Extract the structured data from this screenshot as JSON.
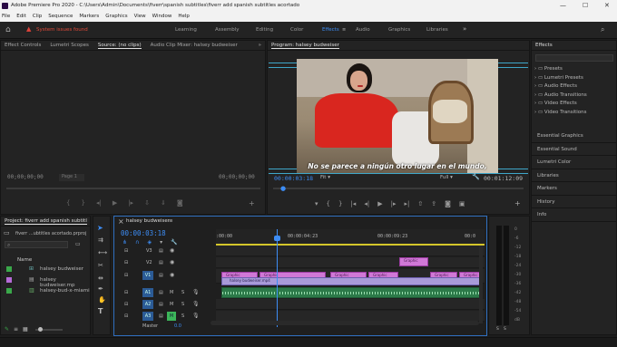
{
  "app": {
    "title": "Adobe Premiere Pro 2020 - C:\\Users\\Admin\\Documents\\fiverr\\spanish subtitles\\fiverr add spanish subtitles acortado",
    "window_controls": [
      "—",
      "☐",
      "✕"
    ]
  },
  "menu": [
    "File",
    "Edit",
    "Clip",
    "Sequence",
    "Markers",
    "Graphics",
    "View",
    "Window",
    "Help"
  ],
  "workspace": {
    "home_icon": "home-icon",
    "alert": "System issues found",
    "tabs": [
      "Learning",
      "Assembly",
      "Editing",
      "Color",
      "Effects",
      "Audio",
      "Graphics",
      "Libraries"
    ],
    "active_tab": "Effects",
    "accent": "#3d8df5"
  },
  "source_panel": {
    "tabs": [
      "Effect Controls",
      "Lumetri Scopes",
      "Source: (no clips)",
      "Audio Clip Mixer: halsey budweiser"
    ],
    "active": "Source: (no clips)",
    "tc_left": "00;00;00;00",
    "page": "Page 1",
    "tc_right": "00;00;00;00"
  },
  "program": {
    "title": "Program: halsey budweiser",
    "subtitle": "No se parece a ningún otro lugar en el mundo,",
    "timecode": "00:00:03:18",
    "fit": "Fit",
    "quality": "Full",
    "duration": "00:01:12:09"
  },
  "effects": {
    "title": "Effects",
    "folders": [
      "Presets",
      "Lumetri Presets",
      "Audio Effects",
      "Audio Transitions",
      "Video Effects",
      "Video Transitions"
    ],
    "panels": [
      "Essential Graphics",
      "Essential Sound",
      "Lumetri Color",
      "Libraries",
      "Markers",
      "History",
      "Info"
    ]
  },
  "project": {
    "title": "Project: fiverr add spanish subtitl",
    "file": "fiverr ...ubtitles acortado.prproj",
    "name_header": "Name",
    "items": [
      {
        "name": "halsey budweiser",
        "color": "#3aa84a"
      },
      {
        "name": "halsey budweiser.mp",
        "color": "#b66bd8"
      },
      {
        "name": "halsey-bud-x-miami",
        "color": "#3aa84a"
      }
    ]
  },
  "timeline": {
    "title": "halsey budweiser",
    "timecode": "00:00:03:18",
    "ruler": [
      ":00:00",
      "00:00:04:23",
      "00:00:09:23",
      "00:0"
    ],
    "tracks_video": [
      "V3",
      "V2",
      "V1"
    ],
    "tracks_audio": [
      "A1",
      "A2",
      "A3"
    ],
    "master": "Master",
    "master_value": "0.0",
    "clip_v1": "halsey budweiser.mp4",
    "graphic": "Graphic",
    "toggles": [
      "M",
      "S"
    ]
  },
  "meter": {
    "labels": [
      "0",
      "-6",
      "-12",
      "-18",
      "-24",
      "-30",
      "-36",
      "-42",
      "-48",
      "-54",
      "dB"
    ],
    "solo": [
      "S",
      "S"
    ]
  }
}
